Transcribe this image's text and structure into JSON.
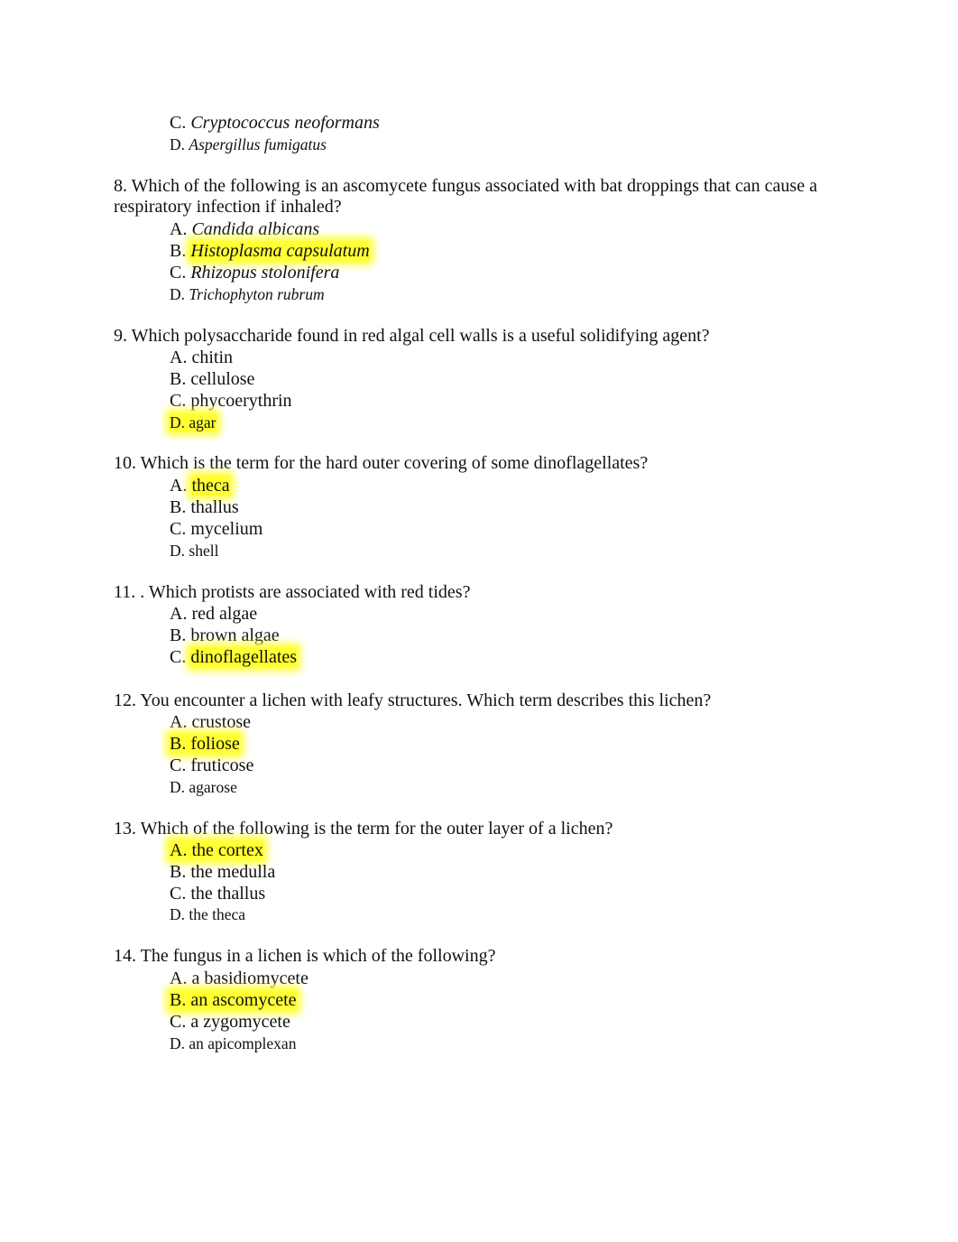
{
  "continued": {
    "options": [
      {
        "letter": "C.",
        "text": "Cryptococcus neoformans",
        "italic": true
      },
      {
        "letter": "D.",
        "text": "Aspergillus fumigatus",
        "italic": true
      }
    ]
  },
  "questions": [
    {
      "number": "8.",
      "text": "Which of the following is an ascomycete fungus associated with bat droppings that can cause a respiratory infection if inhaled?",
      "options": [
        {
          "letter": "A.",
          "text": "Candida albicans"
        },
        {
          "letter": "B.",
          "text": "Histoplasma capsulatum",
          "highlighted": true
        },
        {
          "letter": "C.",
          "text": "Rhizopus stolonifera"
        },
        {
          "letter": "D.",
          "text": "Trichophyton rubrum"
        }
      ]
    },
    {
      "number": "9.",
      "text": "Which polysaccharide found in red algal cell walls is a useful solidifying agent?",
      "options": [
        {
          "letter": "A.",
          "text": "chitin"
        },
        {
          "letter": "B.",
          "text": "cellulose"
        },
        {
          "letter": "C.",
          "text": "phycoerythrin"
        },
        {
          "letter": "D.",
          "text": "agar",
          "highlighted": true
        }
      ]
    },
    {
      "number": "10.",
      "text": "Which is the term for the hard outer covering of some dinoflagellates?",
      "options": [
        {
          "letter": "A.",
          "text": "theca",
          "highlighted": true
        },
        {
          "letter": "B.",
          "text": "thallus"
        },
        {
          "letter": "C.",
          "text": "mycelium"
        },
        {
          "letter": "D.",
          "text": "shell"
        }
      ]
    },
    {
      "number": "11.",
      "text": ". Which protists are associated with red tides?",
      "options": [
        {
          "letter": "A.",
          "text": "red algae"
        },
        {
          "letter": "B.",
          "text": "brown algae"
        },
        {
          "letter": "C.",
          "text": "dinoflagellates",
          "highlighted": true
        }
      ]
    },
    {
      "number": "12.",
      "text": "You encounter a lichen with leafy structures. Which term describes this lichen?",
      "options": [
        {
          "letter": "A.",
          "text": "crustose"
        },
        {
          "letter": "B.",
          "text": "foliose",
          "highlighted": true
        },
        {
          "letter": "C.",
          "text": "fruticose"
        },
        {
          "letter": "D.",
          "text": "agarose"
        }
      ]
    },
    {
      "number": "13.",
      "text": "Which of the following is the term for the outer layer of a lichen?",
      "options": [
        {
          "letter": "A.",
          "text": "the cortex",
          "highlighted": true
        },
        {
          "letter": "B.",
          "text": "the medulla"
        },
        {
          "letter": "C.",
          "text": "the thallus"
        },
        {
          "letter": "D.",
          "text": "the theca"
        }
      ]
    },
    {
      "number": "14.",
      "text": "The fungus in a lichen is which of the following?",
      "options": [
        {
          "letter": "A.",
          "text": "a basidiomycete"
        },
        {
          "letter": "B.",
          "text": "an ascomycete",
          "highlighted": true
        },
        {
          "letter": "C.",
          "text": "a zygomycete"
        },
        {
          "letter": "D.",
          "text": "an apicomplexan"
        }
      ]
    }
  ],
  "highlight_color": "#ffff33"
}
